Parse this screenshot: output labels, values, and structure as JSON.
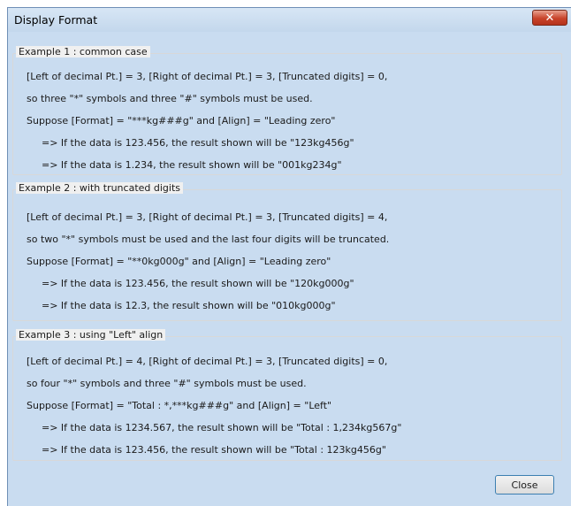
{
  "window": {
    "title": "Display Format",
    "close_glyph": "✕"
  },
  "examples": [
    {
      "title": "Example 1 : common case",
      "lines": [
        "[Left of decimal Pt.] = 3, [Right of decimal Pt.] = 3, [Truncated digits] = 0,",
        "so three \"*\" symbols and three \"#\" symbols must be used.",
        "Suppose [Format] = \"***kg###g\" and [Align] = \"Leading zero\"",
        "=> If the data is 123.456, the result shown will be \"123kg456g\"",
        "=> If the data is 1.234, the result shown will be \"001kg234g\""
      ]
    },
    {
      "title": "Example 2 : with truncated digits",
      "lines": [
        "[Left of decimal Pt.] = 3, [Right of decimal Pt.] = 3, [Truncated digits] = 4,",
        "so two \"*\" symbols must be used and the last four digits will be truncated.",
        "Suppose [Format] = \"**0kg000g\" and [Align] = \"Leading zero\"",
        "=> If the data is 123.456, the result shown will be \"120kg000g\"",
        "=> If the data is 12.3, the result shown will be \"010kg000g\""
      ]
    },
    {
      "title": "Example 3 : using \"Left\" align",
      "lines": [
        "[Left of decimal Pt.] = 4, [Right of decimal Pt.] = 3, [Truncated digits] = 0,",
        "so four \"*\" symbols and three \"#\" symbols must be used.",
        "Suppose [Format] = \"Total : *,***kg###g\" and [Align] = \"Left\"",
        "=> If the data is 1234.567, the result shown will be \"Total : 1,234kg567g\"",
        "=> If the data is 123.456, the result shown will be \"Total : 123kg456g\""
      ]
    }
  ],
  "buttons": {
    "close_label": "Close"
  },
  "colors": {
    "title_bg": "#c9dcf0",
    "close_red": "#c8432a",
    "dialog_bg": "#f0f0f0",
    "button_border": "#3c7fb1"
  }
}
